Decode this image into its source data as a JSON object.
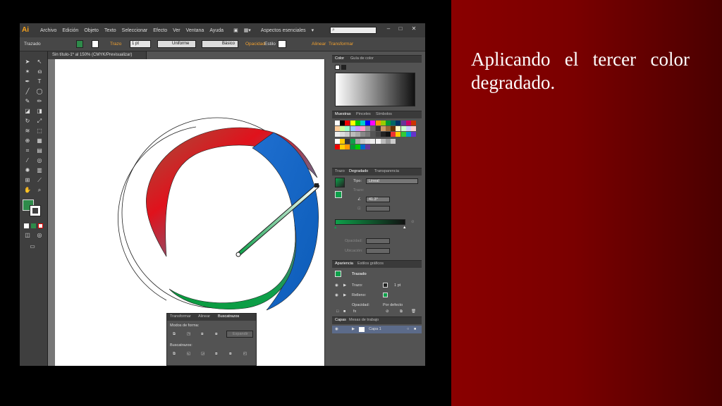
{
  "slide": {
    "caption": "Aplicando el tercer color degradado.",
    "background_color": "#7a0000"
  },
  "app": {
    "logo": "Ai",
    "menus": [
      "Archivo",
      "Edición",
      "Objeto",
      "Texto",
      "Seleccionar",
      "Efecto",
      "Ver",
      "Ventana",
      "Ayuda"
    ],
    "workspace": "Aspectos esenciales",
    "window_controls": [
      "–",
      "□",
      "✕"
    ],
    "control_bar": {
      "selection": "Trazado",
      "stroke_label": "Trazo",
      "stroke_value": "1 pt",
      "profile": "Uniforme",
      "brush": "Básico",
      "opacity_label": "Opacidad",
      "style_label": "Estilo",
      "align_label": "Alinear",
      "transform_label": "Transformar"
    },
    "document_tab": "Sin título-1* al 150% (CMYK/Previsualizar)"
  },
  "panels": {
    "color": {
      "tabs": [
        "Color",
        "Guía de color"
      ]
    },
    "swatches": {
      "tabs": [
        "Muestras",
        "Pinceles",
        "Símbolos"
      ]
    },
    "gradient": {
      "tabs": [
        "Trazo",
        "Degradado",
        "Transparencia"
      ],
      "type_label": "Tipo:",
      "type_value": "Lineal",
      "stroke_label": "Trazo:",
      "angle_value": "41.3°",
      "opacity_label": "Opacidad:",
      "location_label": "Ubicación:"
    },
    "appearance": {
      "tabs": [
        "Apariencia",
        "Estilos gráficos"
      ],
      "title": "Trazado",
      "stroke_label": "Trazo:",
      "stroke_value": "1 pt",
      "fill_label": "Relleno:",
      "opacity_label": "Opacidad:",
      "opacity_value": "Por defecto"
    },
    "layers": {
      "tabs": [
        "Capas",
        "Mesas de trabajo"
      ],
      "layer_name": "Capa 1"
    },
    "pathfinder": {
      "tabs": [
        "Transformar",
        "Alinear",
        "Buscatrazos"
      ],
      "shape_modes_label": "Modos de forma:",
      "expand_label": "Expandir",
      "pathfinders_label": "Buscatrazos:"
    }
  },
  "colors": {
    "gradient_red": "#e0121c",
    "gradient_blue": "#1f6fd0",
    "gradient_green": "#0ea04a",
    "gradient_brown": "#8b4a3a",
    "ui_dark": "#535353",
    "accent_orange": "#f0a030"
  }
}
